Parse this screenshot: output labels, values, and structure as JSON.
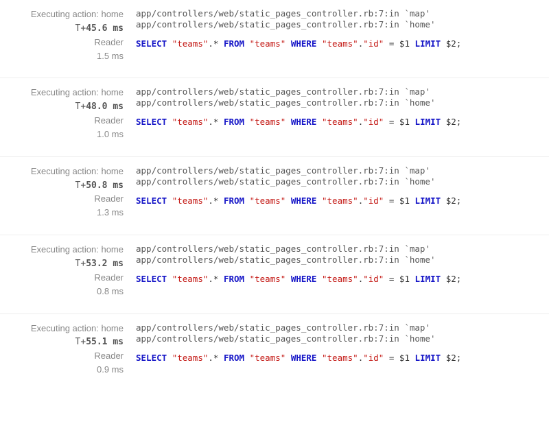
{
  "entries": [
    {
      "action_label": "Executing action: home",
      "time_label": "T+45.6 ms",
      "role": "Reader",
      "duration": "1.5 ms",
      "trace_lines": [
        "app/controllers/web/static_pages_controller.rb:7:in `map'",
        "app/controllers/web/static_pages_controller.rb:7:in `home'"
      ],
      "sql_tokens": [
        {
          "t": "kw",
          "v": "SELECT"
        },
        {
          "t": "sp"
        },
        {
          "t": "str",
          "v": "\"teams\""
        },
        {
          "t": "punct",
          "v": ".*"
        },
        {
          "t": "sp"
        },
        {
          "t": "kw",
          "v": "FROM"
        },
        {
          "t": "sp"
        },
        {
          "t": "str",
          "v": "\"teams\""
        },
        {
          "t": "sp"
        },
        {
          "t": "kw",
          "v": "WHERE"
        },
        {
          "t": "sp"
        },
        {
          "t": "str",
          "v": "\"teams\""
        },
        {
          "t": "punct",
          "v": "."
        },
        {
          "t": "str",
          "v": "\"id\""
        },
        {
          "t": "sp"
        },
        {
          "t": "punct",
          "v": "="
        },
        {
          "t": "sp"
        },
        {
          "t": "lit",
          "v": "$1"
        },
        {
          "t": "sp"
        },
        {
          "t": "kw",
          "v": "LIMIT"
        },
        {
          "t": "sp"
        },
        {
          "t": "lit",
          "v": "$2"
        },
        {
          "t": "punct",
          "v": ";"
        }
      ]
    },
    {
      "action_label": "Executing action: home",
      "time_label": "T+48.0 ms",
      "role": "Reader",
      "duration": "1.0 ms",
      "trace_lines": [
        "app/controllers/web/static_pages_controller.rb:7:in `map'",
        "app/controllers/web/static_pages_controller.rb:7:in `home'"
      ],
      "sql_tokens": [
        {
          "t": "kw",
          "v": "SELECT"
        },
        {
          "t": "sp"
        },
        {
          "t": "str",
          "v": "\"teams\""
        },
        {
          "t": "punct",
          "v": ".*"
        },
        {
          "t": "sp"
        },
        {
          "t": "kw",
          "v": "FROM"
        },
        {
          "t": "sp"
        },
        {
          "t": "str",
          "v": "\"teams\""
        },
        {
          "t": "sp"
        },
        {
          "t": "kw",
          "v": "WHERE"
        },
        {
          "t": "sp"
        },
        {
          "t": "str",
          "v": "\"teams\""
        },
        {
          "t": "punct",
          "v": "."
        },
        {
          "t": "str",
          "v": "\"id\""
        },
        {
          "t": "sp"
        },
        {
          "t": "punct",
          "v": "="
        },
        {
          "t": "sp"
        },
        {
          "t": "lit",
          "v": "$1"
        },
        {
          "t": "sp"
        },
        {
          "t": "kw",
          "v": "LIMIT"
        },
        {
          "t": "sp"
        },
        {
          "t": "lit",
          "v": "$2"
        },
        {
          "t": "punct",
          "v": ";"
        }
      ]
    },
    {
      "action_label": "Executing action: home",
      "time_label": "T+50.8 ms",
      "role": "Reader",
      "duration": "1.3 ms",
      "trace_lines": [
        "app/controllers/web/static_pages_controller.rb:7:in `map'",
        "app/controllers/web/static_pages_controller.rb:7:in `home'"
      ],
      "sql_tokens": [
        {
          "t": "kw",
          "v": "SELECT"
        },
        {
          "t": "sp"
        },
        {
          "t": "str",
          "v": "\"teams\""
        },
        {
          "t": "punct",
          "v": ".*"
        },
        {
          "t": "sp"
        },
        {
          "t": "kw",
          "v": "FROM"
        },
        {
          "t": "sp"
        },
        {
          "t": "str",
          "v": "\"teams\""
        },
        {
          "t": "sp"
        },
        {
          "t": "kw",
          "v": "WHERE"
        },
        {
          "t": "sp"
        },
        {
          "t": "str",
          "v": "\"teams\""
        },
        {
          "t": "punct",
          "v": "."
        },
        {
          "t": "str",
          "v": "\"id\""
        },
        {
          "t": "sp"
        },
        {
          "t": "punct",
          "v": "="
        },
        {
          "t": "sp"
        },
        {
          "t": "lit",
          "v": "$1"
        },
        {
          "t": "sp"
        },
        {
          "t": "kw",
          "v": "LIMIT"
        },
        {
          "t": "sp"
        },
        {
          "t": "lit",
          "v": "$2"
        },
        {
          "t": "punct",
          "v": ";"
        }
      ]
    },
    {
      "action_label": "Executing action: home",
      "time_label": "T+53.2 ms",
      "role": "Reader",
      "duration": "0.8 ms",
      "trace_lines": [
        "app/controllers/web/static_pages_controller.rb:7:in `map'",
        "app/controllers/web/static_pages_controller.rb:7:in `home'"
      ],
      "sql_tokens": [
        {
          "t": "kw",
          "v": "SELECT"
        },
        {
          "t": "sp"
        },
        {
          "t": "str",
          "v": "\"teams\""
        },
        {
          "t": "punct",
          "v": ".*"
        },
        {
          "t": "sp"
        },
        {
          "t": "kw",
          "v": "FROM"
        },
        {
          "t": "sp"
        },
        {
          "t": "str",
          "v": "\"teams\""
        },
        {
          "t": "sp"
        },
        {
          "t": "kw",
          "v": "WHERE"
        },
        {
          "t": "sp"
        },
        {
          "t": "str",
          "v": "\"teams\""
        },
        {
          "t": "punct",
          "v": "."
        },
        {
          "t": "str",
          "v": "\"id\""
        },
        {
          "t": "sp"
        },
        {
          "t": "punct",
          "v": "="
        },
        {
          "t": "sp"
        },
        {
          "t": "lit",
          "v": "$1"
        },
        {
          "t": "sp"
        },
        {
          "t": "kw",
          "v": "LIMIT"
        },
        {
          "t": "sp"
        },
        {
          "t": "lit",
          "v": "$2"
        },
        {
          "t": "punct",
          "v": ";"
        }
      ]
    },
    {
      "action_label": "Executing action: home",
      "time_label": "T+55.1 ms",
      "role": "Reader",
      "duration": "0.9 ms",
      "trace_lines": [
        "app/controllers/web/static_pages_controller.rb:7:in `map'",
        "app/controllers/web/static_pages_controller.rb:7:in `home'"
      ],
      "sql_tokens": [
        {
          "t": "kw",
          "v": "SELECT"
        },
        {
          "t": "sp"
        },
        {
          "t": "str",
          "v": "\"teams\""
        },
        {
          "t": "punct",
          "v": ".*"
        },
        {
          "t": "sp"
        },
        {
          "t": "kw",
          "v": "FROM"
        },
        {
          "t": "sp"
        },
        {
          "t": "str",
          "v": "\"teams\""
        },
        {
          "t": "sp"
        },
        {
          "t": "kw",
          "v": "WHERE"
        },
        {
          "t": "sp"
        },
        {
          "t": "str",
          "v": "\"teams\""
        },
        {
          "t": "punct",
          "v": "."
        },
        {
          "t": "str",
          "v": "\"id\""
        },
        {
          "t": "sp"
        },
        {
          "t": "punct",
          "v": "="
        },
        {
          "t": "sp"
        },
        {
          "t": "lit",
          "v": "$1"
        },
        {
          "t": "sp"
        },
        {
          "t": "kw",
          "v": "LIMIT"
        },
        {
          "t": "sp"
        },
        {
          "t": "lit",
          "v": "$2"
        },
        {
          "t": "punct",
          "v": ";"
        }
      ]
    }
  ]
}
